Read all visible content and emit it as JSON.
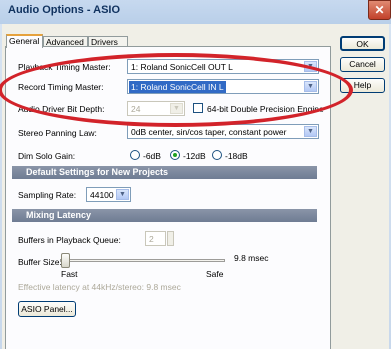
{
  "window": {
    "title": "Audio Options - ASIO",
    "close_glyph": "✕"
  },
  "tabs": [
    "General",
    "Advanced",
    "Drivers"
  ],
  "buttons": {
    "ok": "OK",
    "cancel": "Cancel",
    "help": "Help",
    "asio_panel": "ASIO Panel..."
  },
  "timing": {
    "playback_label": "Playback Timing Master:",
    "playback_value": "1: Roland SonicCell OUT L",
    "record_label": "Record Timing Master:",
    "record_value": "1: Roland SonicCell IN L"
  },
  "bit_depth": {
    "label": "Audio Driver Bit Depth:",
    "value": "24",
    "double_precision_label": "64-bit Double Precision Engine",
    "double_precision_checked": false
  },
  "panning": {
    "label": "Stereo Panning Law:",
    "value": "0dB center, sin/cos taper, constant power"
  },
  "dim_solo": {
    "label": "Dim Solo Gain:",
    "options": [
      "-6dB",
      "-12dB",
      "-18dB"
    ],
    "selected": "-12dB"
  },
  "defaults_section": {
    "title": "Default Settings for New Projects",
    "sampling_label": "Sampling Rate:",
    "sampling_value": "44100"
  },
  "latency_section": {
    "title": "Mixing Latency",
    "buffers_label": "Buffers in Playback Queue:",
    "buffers_value": "2",
    "buffer_size_label": "Buffer Size:",
    "buffer_size_value": "9.8 msec",
    "fast_label": "Fast",
    "safe_label": "Safe",
    "effective_latency": "Effective latency at 44kHz/stereo: 9.8 msec"
  },
  "colors": {
    "highlight_oval": "#d2232a",
    "selection": "#316ac5",
    "section_header": "#7a869c"
  },
  "icons": {
    "combo_arrow": "chevron-down-icon",
    "close": "close-icon"
  }
}
